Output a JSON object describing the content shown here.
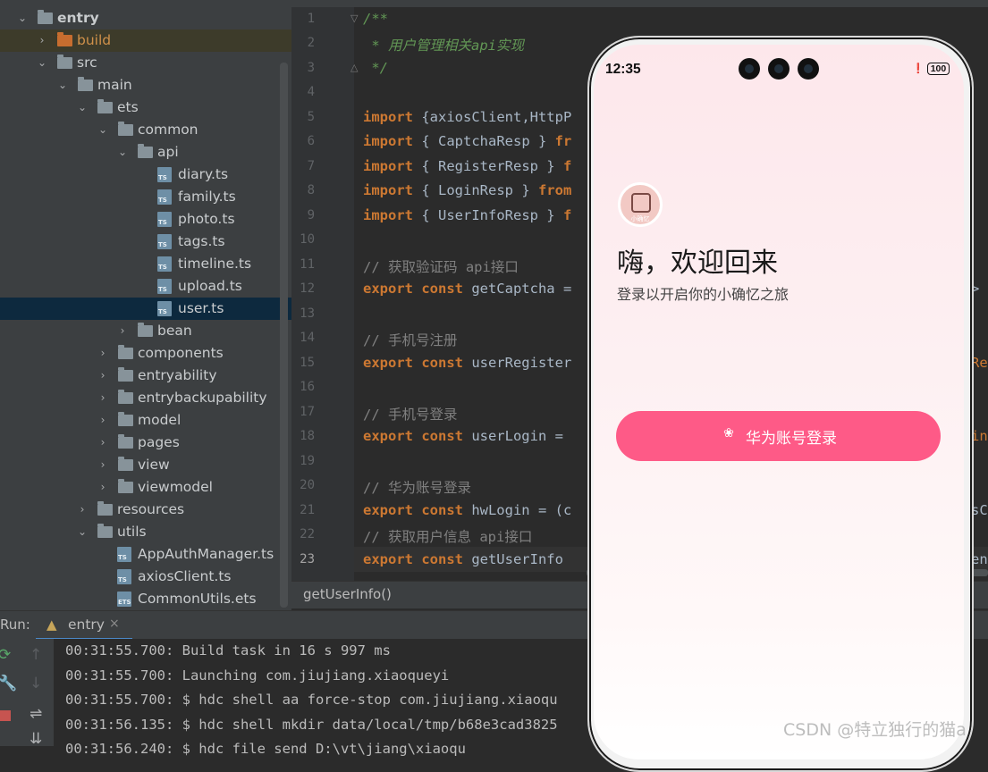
{
  "project_tree": {
    "items": [
      {
        "label": "entry",
        "icon": "module-folder-icon",
        "expanded": true
      },
      {
        "label": "build",
        "icon": "folder-icon",
        "expanded": false
      },
      {
        "label": "src",
        "icon": "folder-icon",
        "expanded": true
      },
      {
        "label": "main",
        "icon": "folder-icon",
        "expanded": true
      },
      {
        "label": "ets",
        "icon": "folder-icon",
        "expanded": true
      },
      {
        "label": "common",
        "icon": "folder-icon",
        "expanded": true
      },
      {
        "label": "api",
        "icon": "folder-icon",
        "expanded": true
      },
      {
        "label": "diary.ts",
        "icon": "ts-file-icon"
      },
      {
        "label": "family.ts",
        "icon": "ts-file-icon"
      },
      {
        "label": "photo.ts",
        "icon": "ts-file-icon"
      },
      {
        "label": "tags.ts",
        "icon": "ts-file-icon"
      },
      {
        "label": "timeline.ts",
        "icon": "ts-file-icon"
      },
      {
        "label": "upload.ts",
        "icon": "ts-file-icon"
      },
      {
        "label": "user.ts",
        "icon": "ts-file-icon",
        "selected": true
      },
      {
        "label": "bean",
        "icon": "folder-icon",
        "expanded": false
      },
      {
        "label": "components",
        "icon": "folder-icon",
        "expanded": false
      },
      {
        "label": "entryability",
        "icon": "folder-icon",
        "expanded": false
      },
      {
        "label": "entrybackupability",
        "icon": "folder-icon",
        "expanded": false
      },
      {
        "label": "model",
        "icon": "folder-icon",
        "expanded": false
      },
      {
        "label": "pages",
        "icon": "folder-icon",
        "expanded": false
      },
      {
        "label": "view",
        "icon": "folder-icon",
        "expanded": false
      },
      {
        "label": "viewmodel",
        "icon": "folder-icon",
        "expanded": false
      },
      {
        "label": "resources",
        "icon": "folder-icon",
        "expanded": false
      },
      {
        "label": "utils",
        "icon": "folder-icon",
        "expanded": true
      },
      {
        "label": "AppAuthManager.ts",
        "icon": "ts-file-icon"
      },
      {
        "label": "axiosClient.ts",
        "icon": "ts-file-icon"
      },
      {
        "label": "CommonUtils.ets",
        "icon": "ets-file-icon"
      }
    ]
  },
  "editor": {
    "line_numbers": [
      "1",
      "2",
      "3",
      "4",
      "5",
      "6",
      "7",
      "8",
      "9",
      "10",
      "11",
      "12",
      "13",
      "14",
      "15",
      "16",
      "17",
      "18",
      "19",
      "20",
      "21",
      "22",
      "23"
    ],
    "current_line": "23",
    "lines": {
      "l1": "/**",
      "l2": " * 用户管理相关api实现",
      "l3": " */",
      "l5_kw": "import",
      "l5_rest": " {axiosClient,HttpP",
      "l6_kw": "import",
      "l6_rest": " { CaptchaResp } ",
      "l6_tail": "fr",
      "l7_kw": "import",
      "l7_rest": " { RegisterResp } ",
      "l7_tail": "f",
      "l8_kw": "import",
      "l8_rest": " { LoginResp } ",
      "l8_tail": "from",
      "l9_kw": "import",
      "l9_rest": " { UserInfoResp } ",
      "l9_tail": "f",
      "l11": "// 获取验证码 api接口",
      "l12_kw": "export const",
      "l12_rest": " getCaptcha = ",
      "l14": "// 手机号注册",
      "l15_kw": "export const",
      "l15_rest": " userRegister",
      "l17": "// 手机号登录",
      "l18_kw": "export const",
      "l18_rest": " userLogin = ",
      "l20": "// 华为账号登录",
      "l21_kw": "export const",
      "l21_rest": " hwLogin = (c",
      "l22": "// 获取用户信息 api接口",
      "l23_kw": "export const",
      "l23_rest": " getUserInfo "
    },
    "right_fragments": {
      "r12": ">",
      "r15": "Re",
      "r18": "in",
      "r21": "sC",
      "r23": "en"
    },
    "breadcrumb": "getUserInfo()"
  },
  "run_panel": {
    "label": "Run:",
    "tab_label": "entry",
    "tab_close": "×",
    "lines": [
      "00:31:55.700: Build task in 16 s 997 ms",
      "00:31:55.700: Launching com.jiujiang.xiaoqueyi",
      "00:31:55.700: $ hdc shell aa force-stop com.jiujiang.xiaoqu",
      "00:31:56.135: $ hdc shell mkdir data/local/tmp/b68e3cad3825",
      "00:31:56.240: $ hdc file send D:\\vt\\jiang\\xiaoqu"
    ]
  },
  "phone": {
    "status_time": "12:35",
    "battery": "100",
    "logo_text": "小确忆",
    "greeting": "嗨，欢迎回来",
    "subtitle": "登录以开启你的小确忆之旅",
    "login_button": "华为账号登录",
    "accent_color": "#fe5a87"
  },
  "watermark": "CSDN @特立独行的猫a"
}
